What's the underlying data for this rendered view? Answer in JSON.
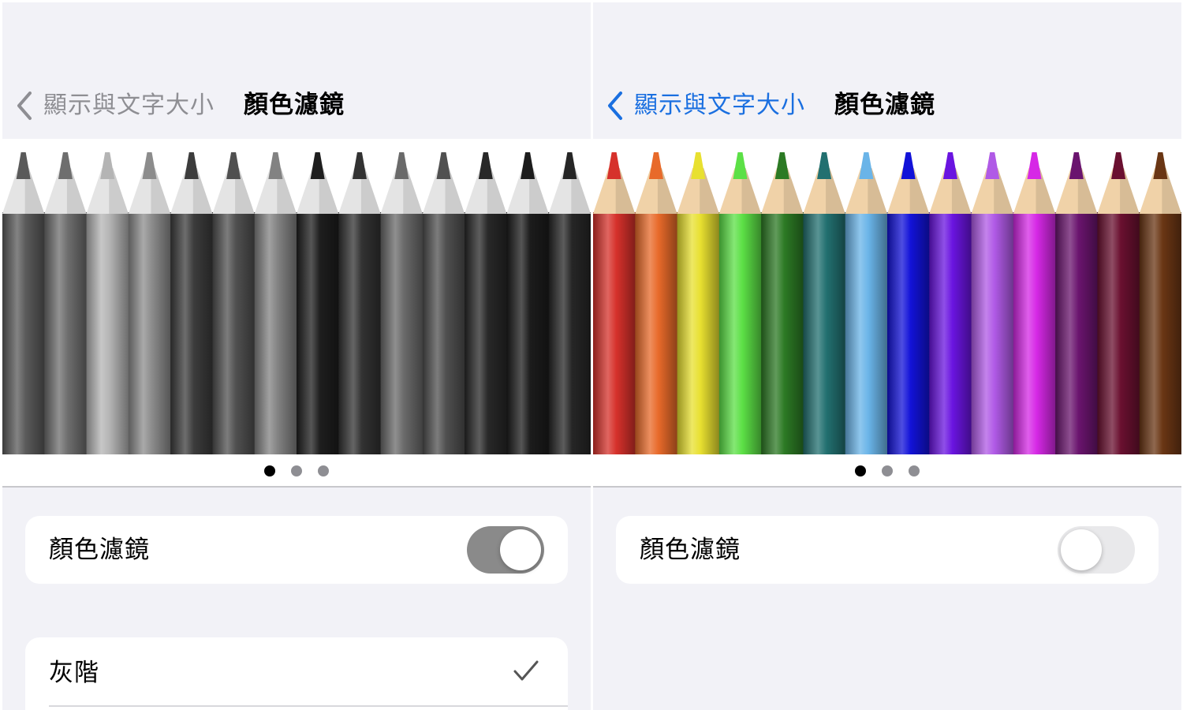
{
  "left_panel": {
    "back_label": "顯示與文字大小",
    "title": "顏色濾鏡",
    "toggle_label": "顏色濾鏡",
    "toggle_on": true,
    "page_dots": {
      "count": 3,
      "active": 0
    },
    "option_label": "灰階",
    "option_selected": true,
    "colors": {
      "back_tint": "#8e8e93",
      "switch_on": "#8a8a8a",
      "pencils": [
        "#5a5a5a",
        "#6e6e6e",
        "#b4b4b4",
        "#8c8c8c",
        "#3c3c3c",
        "#505050",
        "#828282",
        "#1e1e1e",
        "#323232",
        "#6a6a6a",
        "#505050",
        "#282828",
        "#1c1c1c",
        "#262626"
      ]
    },
    "icons": [
      "chevron-left-icon",
      "checkmark-icon"
    ]
  },
  "right_panel": {
    "back_label": "顯示與文字大小",
    "title": "顏色濾鏡",
    "toggle_label": "顏色濾鏡",
    "toggle_on": false,
    "page_dots": {
      "count": 3,
      "active": 0
    },
    "colors": {
      "back_tint": "#1a6fe0",
      "switch_off": "#e9e9eb",
      "pencils": [
        "#d6312b",
        "#e86a2a",
        "#e8e030",
        "#5ce046",
        "#2c7a24",
        "#227070",
        "#6ab4e8",
        "#1212d8",
        "#6a14e0",
        "#b05ae6",
        "#d628e6",
        "#6a146e",
        "#6a1030",
        "#6a3614"
      ]
    },
    "icons": [
      "chevron-left-icon"
    ]
  }
}
